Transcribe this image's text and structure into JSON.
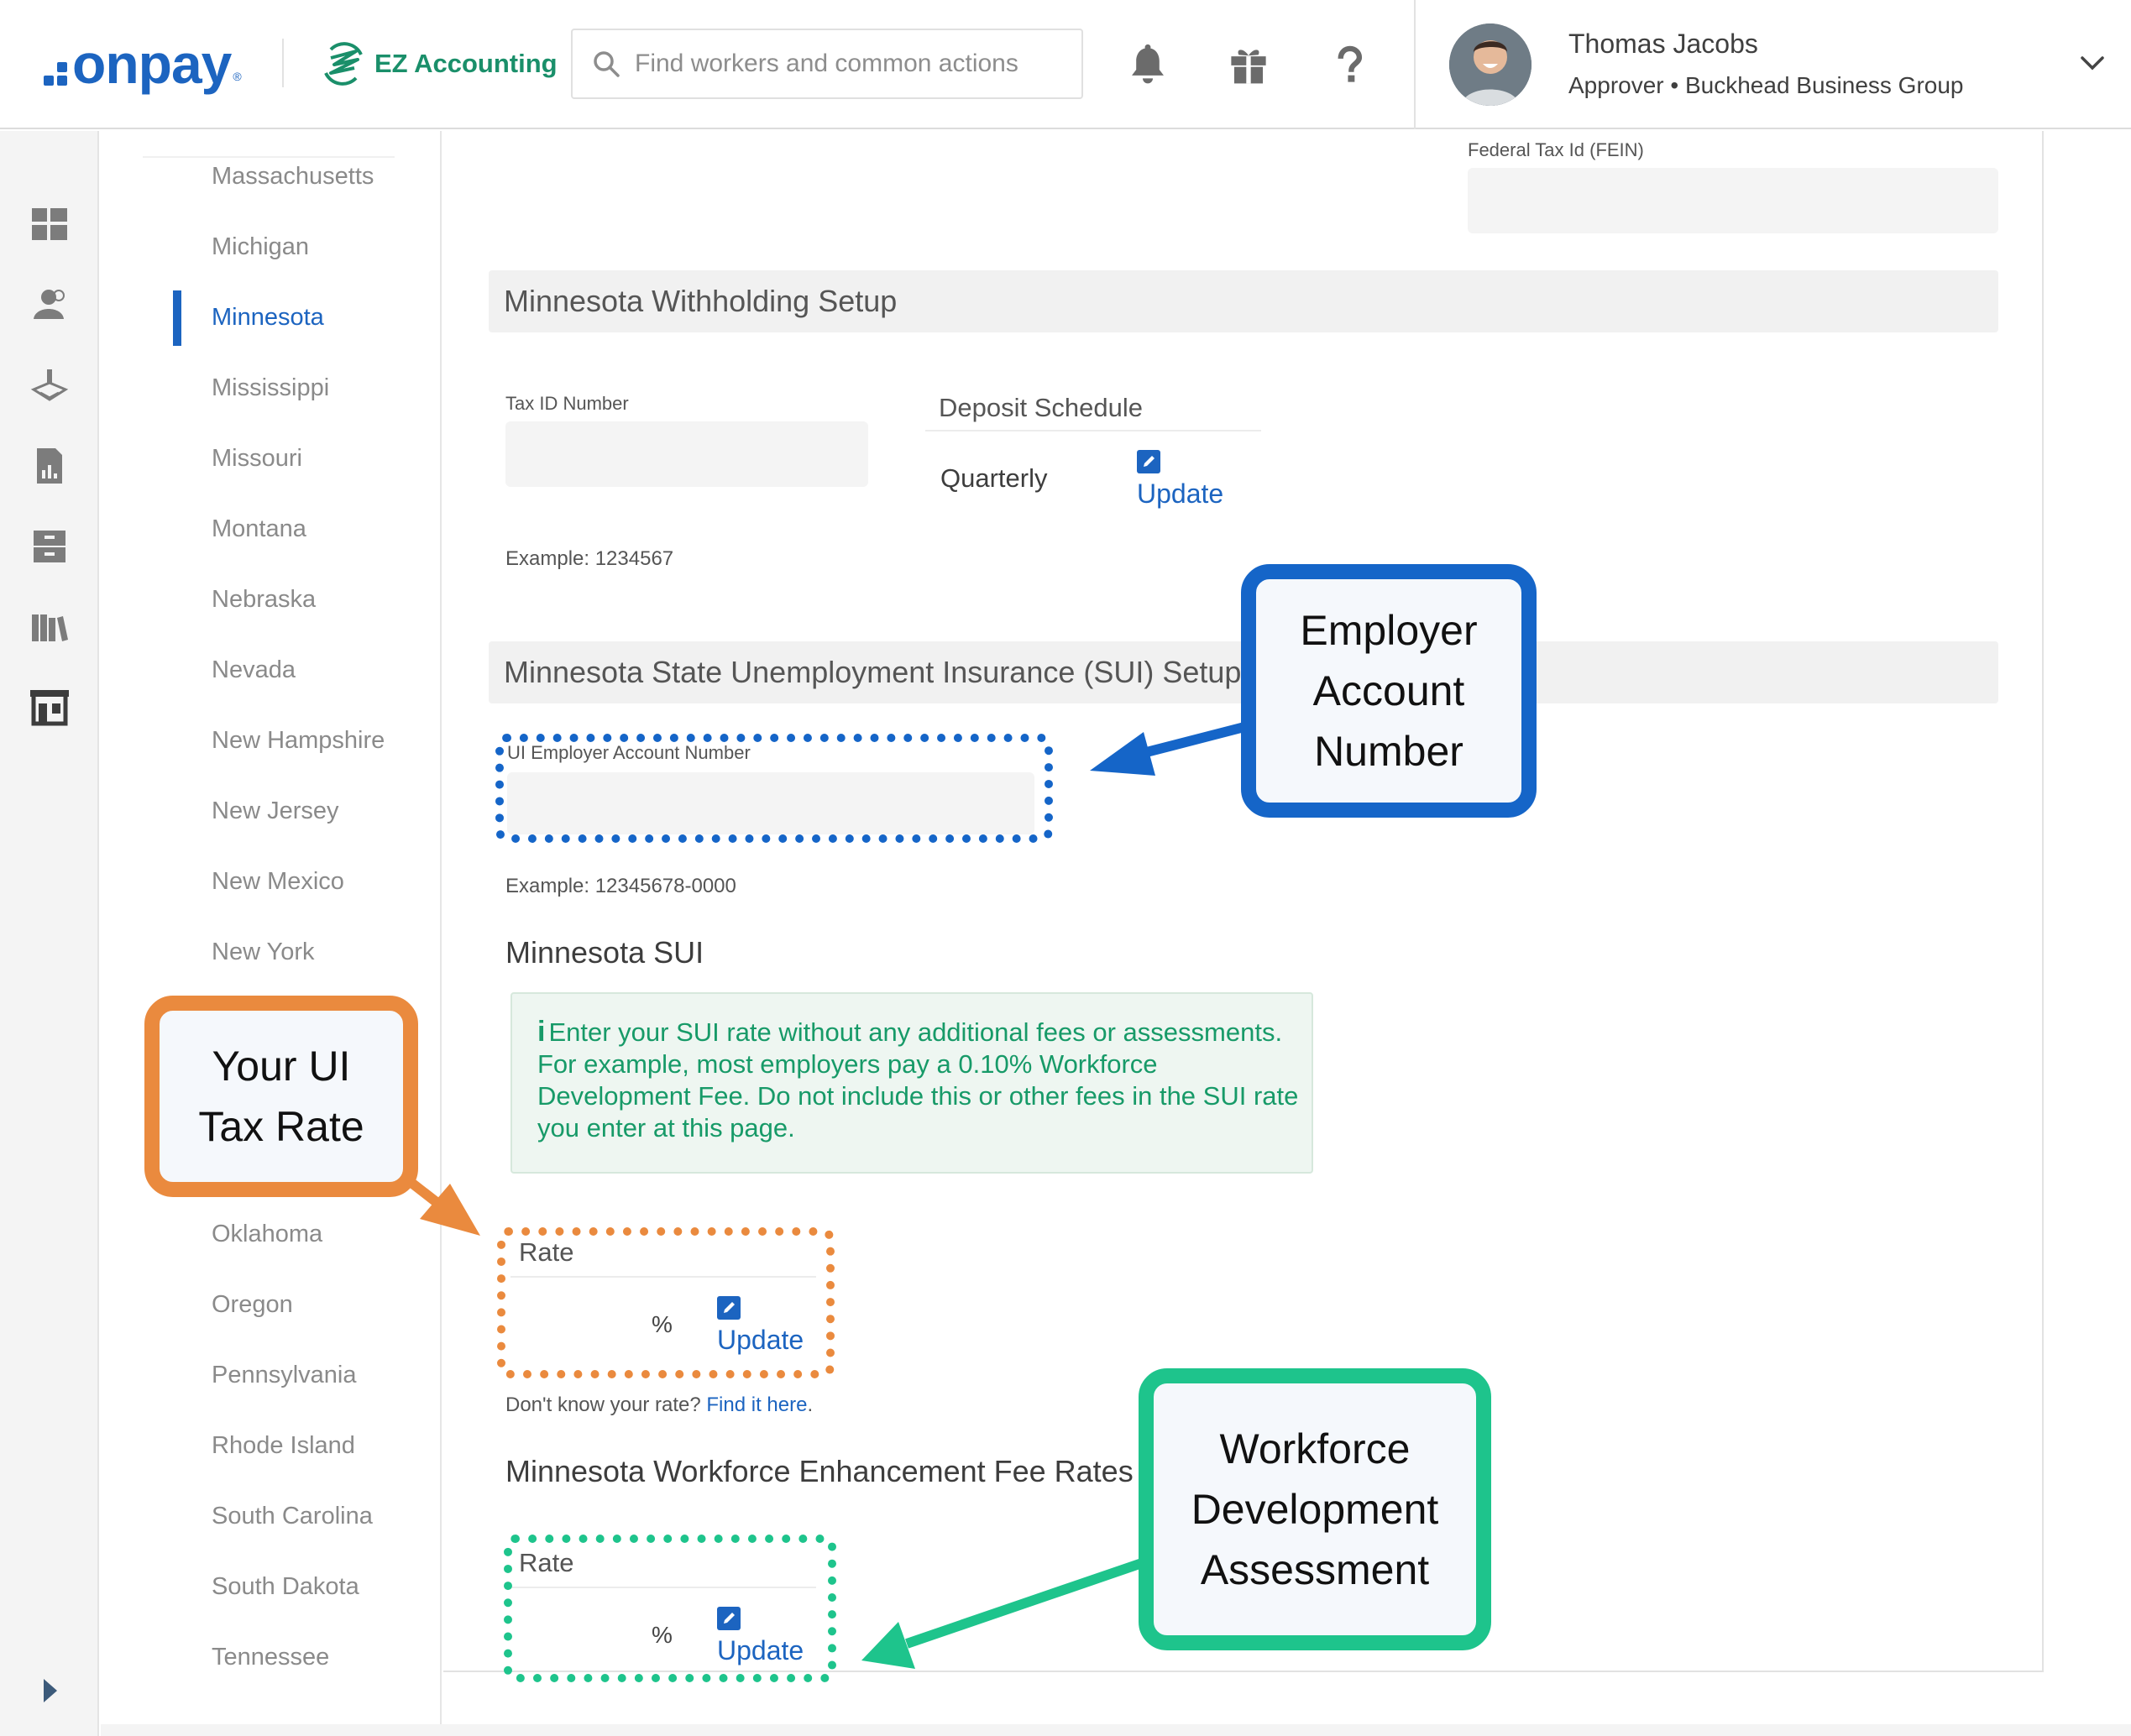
{
  "header": {
    "logo_text": "onpay",
    "logo_mark": "®",
    "ez_accounting_label": "EZ Accounting",
    "search_placeholder": "Find workers and common actions",
    "icons": [
      "bell-icon",
      "gift-icon",
      "help-icon"
    ],
    "user": {
      "name": "Thomas Jacobs",
      "role": "Approver • Buckhead Business Group"
    }
  },
  "rail": {
    "icons": [
      "dashboard-icon",
      "people-icon",
      "payroll-icon",
      "reports-icon",
      "archive-icon",
      "library-icon",
      "store-icon",
      "expand-icon"
    ]
  },
  "states": {
    "items": [
      "Massachusetts",
      "Michigan",
      "Minnesota",
      "Mississippi",
      "Missouri",
      "Montana",
      "Nebraska",
      "Nevada",
      "New Hampshire",
      "New Jersey",
      "New Mexico",
      "New York",
      "Oklahoma",
      "Oregon",
      "Pennsylvania",
      "Rhode Island",
      "South Carolina",
      "South Dakota",
      "Tennessee"
    ],
    "active": "Minnesota"
  },
  "main": {
    "fein_label": "Federal Tax Id (FEIN)",
    "fein_value": "",
    "withholding": {
      "title": "Minnesota Withholding Setup",
      "tax_id_label": "Tax ID Number",
      "tax_id_value": "",
      "tax_id_example": "Example: 1234567",
      "deposit_schedule_label": "Deposit Schedule",
      "deposit_schedule_value": "Quarterly",
      "update_label": "Update"
    },
    "sui": {
      "title": "Minnesota State Unemployment Insurance (SUI) Setup",
      "account_label": "UI Employer Account Number",
      "account_value": "",
      "account_example": "Example: 12345678-0000",
      "sui_heading": "Minnesota SUI",
      "info_text": "Enter your SUI rate without any additional fees or assessments. For example, most employers pay a 0.10% Workforce Development Fee. Do not include this or other fees in the SUI rate you enter at this page.",
      "rate_label": "Rate",
      "rate_value": "",
      "percent": "%",
      "update_label": "Update",
      "dont_know": "Don't know your rate?",
      "find_link": "Find it here",
      "find_period": "."
    },
    "workforce": {
      "title": "Minnesota Workforce Enhancement Fee Rates",
      "rate_label": "Rate",
      "rate_value": "",
      "percent": "%",
      "update_label": "Update"
    }
  },
  "annotations": {
    "employer": {
      "lines": [
        "Employer",
        "Account",
        "Number"
      ],
      "color": "#1565c8"
    },
    "ui_rate": {
      "lines": [
        "Your UI",
        "Tax Rate"
      ],
      "color": "#ea8a3e"
    },
    "workforce": {
      "lines": [
        "Workforce",
        "Development",
        "Assessment"
      ],
      "color": "#1ec48c"
    }
  }
}
